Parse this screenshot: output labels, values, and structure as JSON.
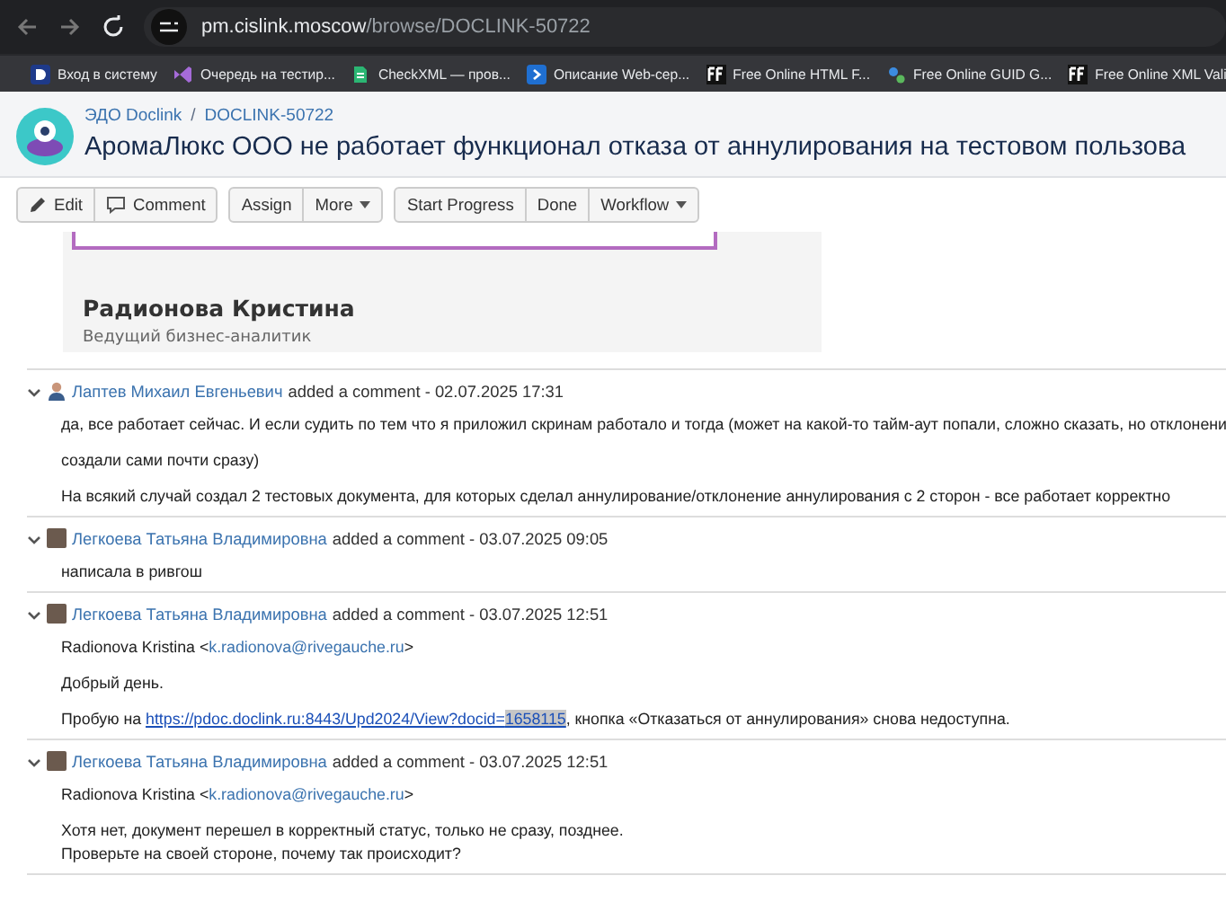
{
  "browser": {
    "url_host": "pm.cislink.moscow",
    "url_path": "/browse/DOCLINK-50722"
  },
  "bookmarks": [
    {
      "label": "Вход в систему",
      "kind": "doclink"
    },
    {
      "label": "Очередь на тестир...",
      "kind": "vs"
    },
    {
      "label": "CheckXML — пров...",
      "kind": "check"
    },
    {
      "label": "Описание Web-сер...",
      "kind": "web"
    },
    {
      "label": "Free Online HTML F...",
      "kind": "ff"
    },
    {
      "label": "Free Online GUID G...",
      "kind": "guid"
    },
    {
      "label": "Free Online XML Vali",
      "kind": "ff"
    }
  ],
  "breadcrumbs": [
    "ЭДО Doclink",
    "DOCLINK-50722"
  ],
  "breadcrumb_separator": "/",
  "issue_title": "АромаЛюкс ООО не работает функционал отказа от аннулирования на тестовом пользова",
  "toolbar": [
    [
      {
        "label": "Edit",
        "kind": "edit"
      },
      {
        "label": "Comment",
        "kind": "comment"
      }
    ],
    [
      {
        "label": "Assign",
        "kind": "plain"
      },
      {
        "label": "More",
        "kind": "dropdown"
      }
    ],
    [
      {
        "label": "Start Progress",
        "kind": "plain"
      },
      {
        "label": "Done",
        "kind": "plain"
      },
      {
        "label": "Workflow",
        "kind": "dropdown"
      }
    ]
  ],
  "signature": {
    "name": "Радионова Кристина",
    "role": "Ведущий бизнес-аналитик"
  },
  "comments": [
    {
      "author": "Лаптев Михаил Евгеньевич",
      "action": "added a comment - 02.07.2025 17:31",
      "kind": "person",
      "paragraphs": [
        [
          {
            "kind": "text",
            "text": "да, все работает сейчас. И если судить по тем что я приложил скринам работало и тогда (может на какой-то тайм-аут попали, сложно сказать, но отклонени"
          }
        ],
        [
          {
            "kind": "text",
            "text": "создали сами почти сразу)"
          }
        ],
        [
          {
            "kind": "text",
            "text": "На всякий случай создал 2 тестовых документа, для которых сделал аннулирование/отклонение аннулирования с 2 сторон - все работает корректно"
          }
        ]
      ]
    },
    {
      "author": "Легкоева Татьяна Владимировна",
      "action": "added a comment - 03.07.2025 09:05",
      "kind": "photo",
      "paragraphs": [
        [
          {
            "kind": "text",
            "text": "написала в ривгош"
          }
        ]
      ]
    },
    {
      "author": "Легкоева Татьяна Владимировна",
      "action": "added a comment - 03.07.2025 12:51",
      "kind": "photo",
      "paragraphs": [
        [
          {
            "kind": "text",
            "text": "Radionova Kristina <"
          },
          {
            "kind": "link",
            "text": "k.radionova@rivegauche.ru"
          },
          {
            "kind": "text",
            "text": ">"
          }
        ],
        [
          {
            "kind": "text",
            "text": "Добрый день."
          }
        ],
        [
          {
            "kind": "text",
            "text": "Пробую на "
          },
          {
            "kind": "url",
            "text": "https://pdoc.doclink.ru:8443/Upd2024/View?docid=",
            "selected": false
          },
          {
            "kind": "url",
            "text": "1658115",
            "selected": true
          },
          {
            "kind": "text",
            "text": ", кнопка «Отказаться от аннулирования» снова недоступна."
          }
        ]
      ]
    },
    {
      "author": "Легкоева Татьяна Владимировна",
      "action": "added a comment - 03.07.2025 12:51",
      "kind": "photo",
      "paragraphs": [
        [
          {
            "kind": "text",
            "text": "Radionova Kristina <"
          },
          {
            "kind": "link",
            "text": "k.radionova@rivegauche.ru"
          },
          {
            "kind": "text",
            "text": ">"
          }
        ],
        [
          {
            "kind": "text",
            "text": "Хотя нет,  документ перешел в корректный статус, только не сразу, позднее."
          },
          {
            "kind": "break"
          },
          {
            "kind": "text",
            "text": "Проверьте на своей стороне, почему так происходит?"
          }
        ]
      ]
    }
  ]
}
